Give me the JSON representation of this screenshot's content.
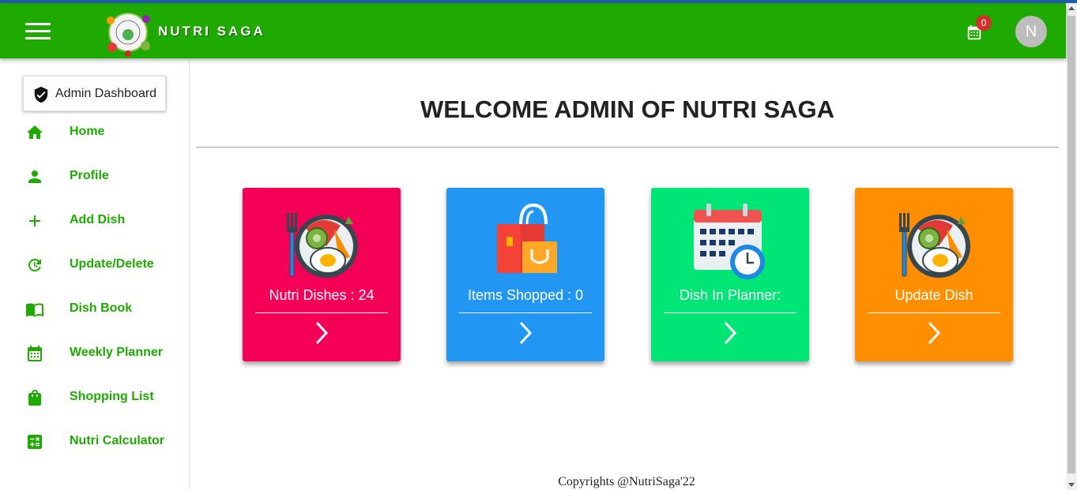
{
  "app": {
    "brand": "NUTRI SAGA",
    "cart_count": "0",
    "avatar_initial": "N",
    "colors": {
      "appbar": "#1eaa00",
      "nav_text": "#1eaa00",
      "badge": "#d32f2f"
    }
  },
  "sidebar": {
    "admin_button": "Admin Dashboard",
    "items": [
      {
        "label": "Home",
        "icon": "home-icon"
      },
      {
        "label": "Profile",
        "icon": "person-icon"
      },
      {
        "label": "Add Dish",
        "icon": "plus-icon"
      },
      {
        "label": "Update/Delete",
        "icon": "refresh-icon"
      },
      {
        "label": "Dish Book",
        "icon": "book-icon"
      },
      {
        "label": "Weekly Planner",
        "icon": "calendar-icon"
      },
      {
        "label": "Shopping List",
        "icon": "shopping-bag-icon"
      },
      {
        "label": "Nutri Calculator",
        "icon": "calculator-icon"
      }
    ]
  },
  "main": {
    "title": "WELCOME ADMIN OF NUTRI SAGA",
    "cards": [
      {
        "label": "Nutri Dishes : 24",
        "color": "#f50057",
        "icon": "dish-icon"
      },
      {
        "label": "Items Shopped : 0",
        "color": "#2196f3",
        "icon": "shopping-bags-icon"
      },
      {
        "label": "Dish In Planner:",
        "color": "#00e676",
        "icon": "calendar-clock-icon"
      },
      {
        "label": "Update Dish",
        "color": "#ff8f00",
        "icon": "dish-icon"
      }
    ]
  },
  "footer": {
    "text": "Copyrights @NutriSaga'22"
  }
}
